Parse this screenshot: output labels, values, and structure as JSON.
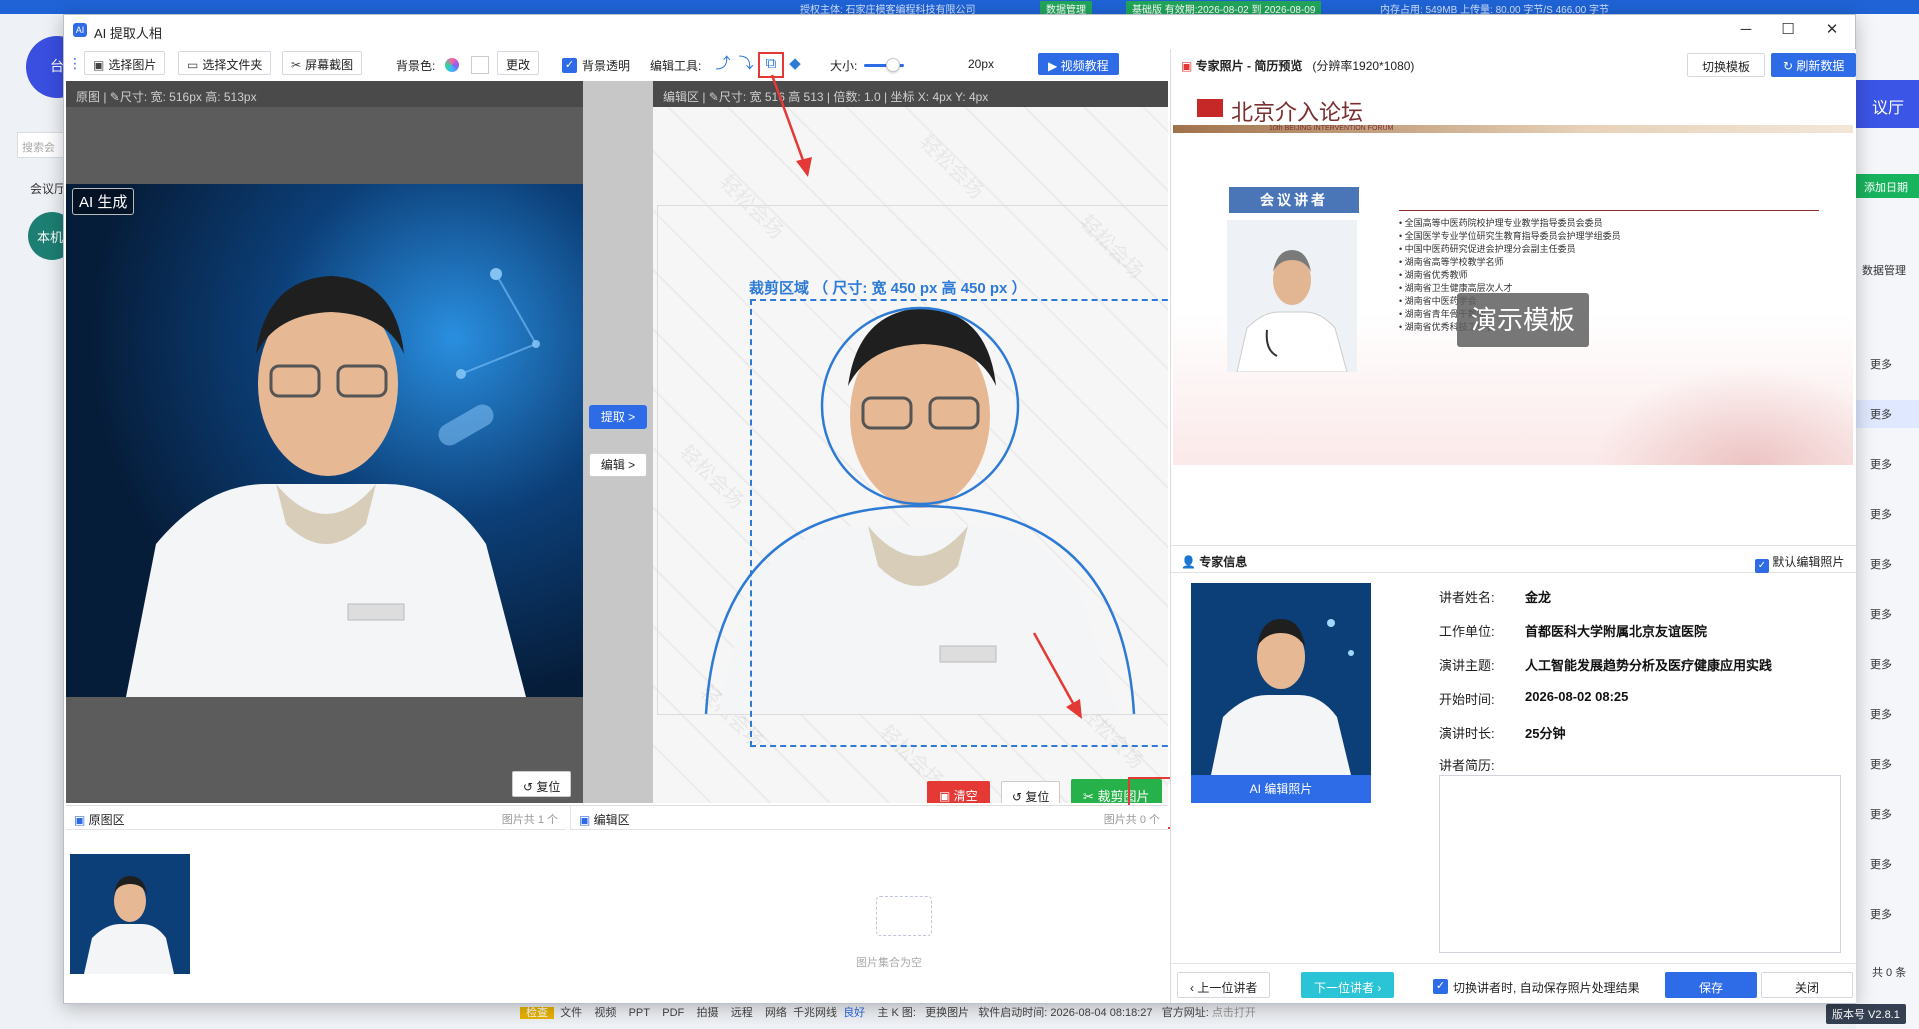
{
  "background": {
    "top_notice": "授权主体: 石家庄模客编程科技有限公司",
    "data_mgmt_badge": "数据管理",
    "trial_badge": "基础版 有效期:2026-08-02 到 2026-08-09",
    "memory": "内存占用: 549MB  上传量: 80.00 字节/S  466.00 字节",
    "logo_text": "台",
    "search_placeholder": "搜索会",
    "hall_tab": "会议厅",
    "avatar_text": "本机",
    "hall_button": "议厅",
    "add_date": "添加日期",
    "data_mgmt": "数据管理",
    "more_label": "更多",
    "total": "共 0 条",
    "version": "版本号 V2.8.1",
    "status_items": [
      "检查",
      "文件",
      "视频",
      "PPT",
      "PDF",
      "拍摄",
      "远程",
      "网络",
      "千兆网线",
      "良好",
      "主 K 图:",
      "更换图片",
      "软件启动时间: 2026-08-04 08:18:27",
      "官方网址:",
      "点击打开"
    ]
  },
  "window": {
    "title": "AI 提取人相",
    "min": "─",
    "max": "☐",
    "close": "✕"
  },
  "toolbar": {
    "choose_image": "选择图片",
    "choose_folder": "选择文件夹",
    "screenshot": "屏幕截图",
    "bg_color_label": "背景色:",
    "change": "更改",
    "bg_transparent": "背景透明",
    "edit_tools_label": "编辑工具:",
    "size_label": "大小:",
    "size_value": "20px",
    "size_level": 0.5,
    "video_tutorial": "视频教程"
  },
  "original": {
    "header": "原图  |  ✎尺寸:  宽: 516px  高: 513px",
    "ai_tag": "AI 生成",
    "reset": "复位"
  },
  "middle": {
    "extract": "提取 >",
    "edit": "编辑 >"
  },
  "edit_area": {
    "header": "编辑区  |  ✎尺寸:  宽 516  高 513  |  倍数:  1.0  |  坐标  X: 4px  Y: 4px",
    "watermark": "轻松会场",
    "crop_title": "裁剪区域 （ 尺寸:  宽 450 px  高 450 px ）",
    "clear": "清空",
    "reset": "复位",
    "crop": "裁剪图片"
  },
  "bottom": {
    "original_area": "原图区",
    "original_count": "图片共 1 个",
    "edit_area": "编辑区",
    "edit_count": "图片共 0 个",
    "empty_text": "图片集合为空"
  },
  "preview": {
    "title": "专家照片 - 简历预览",
    "resolution": "(分辨率1920*1080)",
    "switch_template": "切换模板",
    "refresh": "刷新数据",
    "forum_name": "北京介入论坛",
    "forum_sub": "10th BEIJING INTERVENTION FORUM",
    "speaker_tag": "会议讲者",
    "demo_tag": "演示模板",
    "bio_lines": [
      "全国高等中医药院校护理专业教学指导委员会委员",
      "全国医学专业学位研究生教育指导委员会护理学组委员",
      "中国中医药研究促进会护理分会副主任委员",
      "湖南省高等学校教学名师",
      "湖南省优秀教师",
      "湖南省卫生健康高层次人才",
      "湖南省中医药学会",
      "湖南省青年骨干教师",
      "湖南省优秀科技工作者"
    ]
  },
  "expert": {
    "section_title": "专家信息",
    "default_edit_photo": "默认编辑照片",
    "ai_edit_photo": "AI 编辑照片",
    "name_label": "讲者姓名:",
    "name": "金龙",
    "unit_label": "工作单位:",
    "unit": "首都医科大学附属北京友谊医院",
    "topic_label": "演讲主题:",
    "topic": "人工智能发展趋势分析及医疗健康应用实践",
    "start_label": "开始时间:",
    "start": "2026-08-02 08:25",
    "duration_label": "演讲时长:",
    "duration": "25分钟",
    "bio_label": "讲者简历:"
  },
  "footer": {
    "prev": "上一位讲者",
    "next": "下一位讲者",
    "auto_save": "切换讲者时, 自动保存照片处理结果",
    "save": "保存",
    "close": "关闭"
  }
}
